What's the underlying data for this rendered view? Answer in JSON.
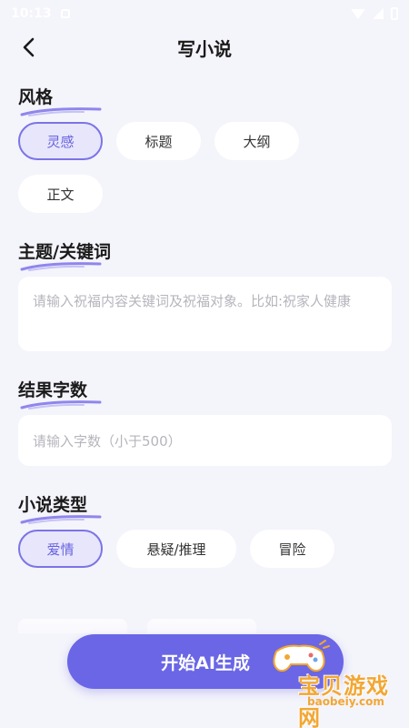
{
  "status_bar": {
    "time": "10:13"
  },
  "header": {
    "title": "写小说"
  },
  "sections": {
    "style": {
      "title": "风格",
      "options": [
        "灵感",
        "标题",
        "大纲",
        "正文"
      ],
      "selected": "灵感"
    },
    "topic": {
      "title": "主题/关键词",
      "placeholder": "请输入祝福内容关键词及祝福对象。比如:祝家人健康"
    },
    "word_count": {
      "title": "结果字数",
      "placeholder": "请输入字数（小于500）"
    },
    "genre": {
      "title": "小说类型",
      "options": [
        "爱情",
        "悬疑/推理",
        "冒险"
      ],
      "selected": "爱情"
    }
  },
  "generate_button": {
    "label": "开始AI生成"
  },
  "watermark": {
    "text": "宝贝游戏网",
    "url": "baobeiy.com"
  },
  "colors": {
    "accent": "#6a66e6",
    "chip_selected_bg": "#e7e6fb",
    "chip_selected_border": "#7b74e6",
    "background": "#f4f4fb",
    "watermark": "#f2a733"
  }
}
